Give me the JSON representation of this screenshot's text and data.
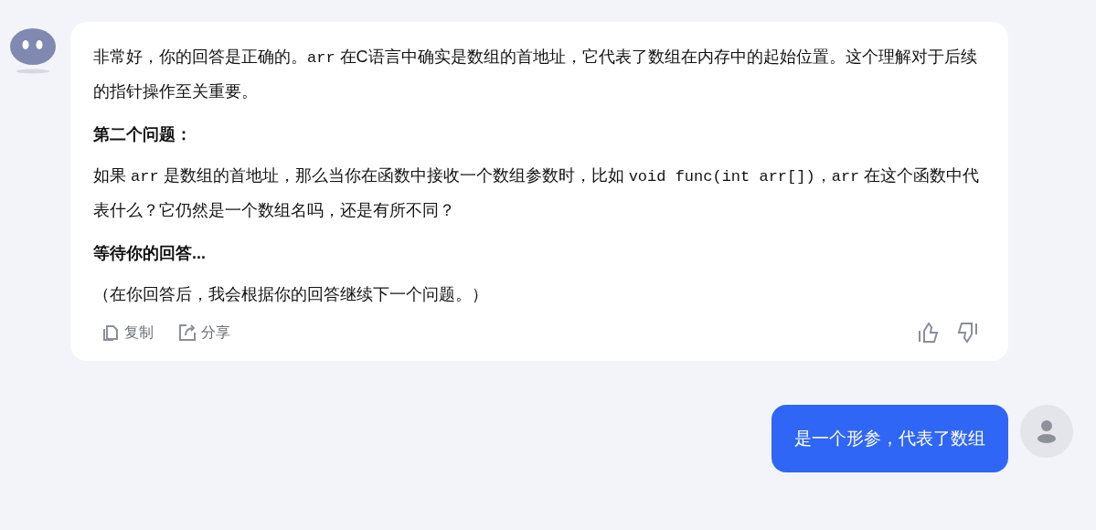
{
  "assistant_message": {
    "blocks": [
      {
        "kind": "paragraph",
        "segments": [
          {
            "kind": "text",
            "text": "非常好，你的回答是正确的。"
          },
          {
            "kind": "code",
            "text": "arr"
          },
          {
            "kind": "text",
            "text": " 在C语言中确实是数组的首地址，它代表了数组在内存中的起始位置。这个理解对于后续的指针操作至关重要。"
          }
        ]
      },
      {
        "kind": "heading",
        "segments": [
          {
            "kind": "text",
            "text": "第二个问题："
          }
        ]
      },
      {
        "kind": "paragraph",
        "segments": [
          {
            "kind": "text",
            "text": "如果 "
          },
          {
            "kind": "code",
            "text": "arr"
          },
          {
            "kind": "text",
            "text": " 是数组的首地址，那么当你在函数中接收一个数组参数时，比如 "
          },
          {
            "kind": "code",
            "text": "void func(int arr[])"
          },
          {
            "kind": "text",
            "text": "，"
          },
          {
            "kind": "code",
            "text": "arr"
          },
          {
            "kind": "text",
            "text": " 在这个函数中代表什么？它仍然是一个数组名吗，还是有所不同？"
          }
        ]
      },
      {
        "kind": "heading",
        "segments": [
          {
            "kind": "text",
            "text": "等待你的回答..."
          }
        ]
      },
      {
        "kind": "paragraph",
        "segments": [
          {
            "kind": "text",
            "text": "（在你回答后，我会根据你的回答继续下一个问题。）"
          }
        ]
      }
    ],
    "actions": [
      {
        "kind": "copy",
        "label": "复制"
      },
      {
        "kind": "share",
        "label": "分享"
      }
    ]
  },
  "user_message": {
    "text": "是一个形参，代表了数组"
  }
}
